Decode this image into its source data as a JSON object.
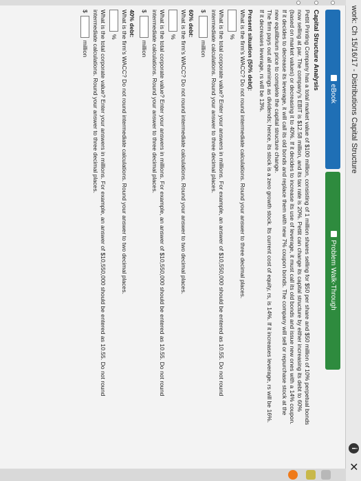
{
  "window": {
    "title": "work: Ch 15/16/17 - Distributions Capital Structure"
  },
  "tabs": {
    "ebook": "eBook",
    "walkthrough": "Problem Walk-Through"
  },
  "problem": {
    "heading": "Capital Structure Analysis",
    "intro1": "Pettit Printing Company has a total market value of $100 million, consisting of 1 million shares selling for $50 per share and $50 million of 10% perpetual bonds",
    "intro2": "now selling at par. The company's EBIT is $12.58 million, and its tax rate is 20%. Pettit can change its capital structure by either increasing its debt to 60%",
    "intro3": "(based on market values) or decreasing it to 40%. If it decides to increase its use of leverage, it must call its old bonds and issue new ones with a 14% coupon.",
    "intro4": "If it decides to decrease its leverage, it will call its old bonds and replace them with new 7% coupon bonds. The company will sell or repurchase stock at the",
    "intro5": "new equilibrium price to complete the capital structure change.",
    "intro6": "The firm pays out all earnings as dividends; hence, its stock is a zero growth stock. Its current cost of equity, rs, is 14%. If it increases leverage, rs will be 16%.",
    "intro7": "If it decreases leverage, rs will be 13%.",
    "s1_title": "Present situation (50% debt):",
    "s1_q1": "What is the firm's WACC? Do not round intermediate calculations. Round your answer to three decimal places.",
    "unit_pct": "%",
    "s1_q2": "What is the total corporate value? Enter your answers in millions. For example, an answer of $10,550,000 should be entered as 10.55. Do not round",
    "s1_q2b": "intermediate calculations. Round your answer to three decimal places.",
    "unit_dollar": "$",
    "unit_million": "million",
    "s2_title": "60% debt:",
    "s2_q1": "What is the firm's WACC? Do not round intermediate calculations. Round your answer to two decimal places.",
    "s2_q2": "What is the total corporate value? Enter your answers in millions. For example, an answer of $10,550,000 should be entered as 10.55. Do not round",
    "s2_q2b": "intermediate calculations. Round your answer to three decimal places.",
    "s3_title": "40% debt:",
    "s3_q1": "What is the firm's WACC? Do not round intermediate calculations. Round your answer to two decimal places.",
    "s3_q2": "What is the total corporate value? Enter your answers in millions. For example, an answer of $10,550,000 should be entered as 10.55. Do not round",
    "s3_q2b": "intermediate calculations. Round your answer to three decimal places."
  },
  "colors": {
    "ebook_tab": "#1f6fb5",
    "walkthrough_tab": "#2e8b3e"
  },
  "icons": [
    "help-icon",
    "close-icon"
  ]
}
